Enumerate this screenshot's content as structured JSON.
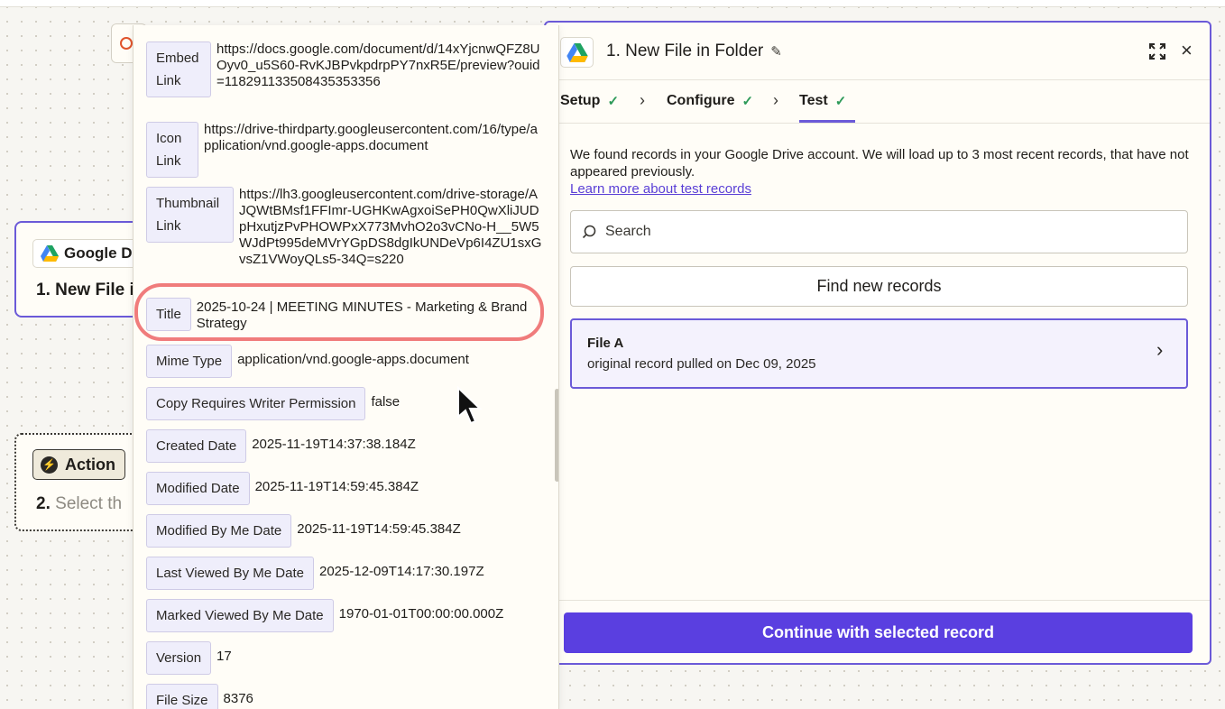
{
  "canvas": {
    "trigger_node": {
      "chip_label": "Google D",
      "title": "1. New File i"
    },
    "action_node": {
      "chip_label": "Action",
      "step_number": "2.",
      "step_text": "Select th"
    }
  },
  "panel": {
    "title": "1. New File in Folder",
    "tabs": [
      {
        "label": "Setup"
      },
      {
        "label": "Configure"
      },
      {
        "label": "Test"
      }
    ],
    "intro_text": "We found records in your Google Drive account. We will load up to 3 most recent records, that have not appeared previously.",
    "learn_more": "Learn more about test records",
    "search_placeholder": "Search",
    "find_button": "Find new records",
    "record": {
      "title": "File A",
      "subtitle": "original record pulled on Dec 09, 2025"
    },
    "continue_button": "Continue with selected record"
  },
  "details": {
    "embed_link": {
      "key": "Embed Link",
      "value": "https://docs.google.com/document/d/14xYjcnwQFZ8UOyv0_u5S60-RvKJBPvkpdrpPY7nxR5E/preview?ouid=118291133508435353356"
    },
    "icon_link": {
      "key": "Icon Link",
      "value": "https://drive-thirdparty.googleusercontent.com/16/type/application/vnd.google-apps.document"
    },
    "thumbnail_link": {
      "key": "Thumbnail Link",
      "value": "https://lh3.googleusercontent.com/drive-storage/AJQWtBMsf1FFImr-UGHKwAgxoiSePH0QwXliJUDpHxutjzPvPHOWPxX773MvhO2o3vCNo-H__5W5WJdPt995deMVrYGpDS8dgIkUNDeVp6I4ZU1sxGvsZ1VWoyQLs5-34Q=s220"
    },
    "title": {
      "key": "Title",
      "value": "2025-10-24 | MEETING MINUTES - Marketing & Brand Strategy"
    },
    "mime_type": {
      "key": "Mime Type",
      "value": "application/vnd.google-apps.document"
    },
    "copy_requires": {
      "key": "Copy Requires Writer Permission",
      "value": "false"
    },
    "created_date": {
      "key": "Created Date",
      "value": "2025-11-19T14:37:38.184Z"
    },
    "modified_date": {
      "key": "Modified Date",
      "value": "2025-11-19T14:59:45.384Z"
    },
    "modified_by_me": {
      "key": "Modified By Me Date",
      "value": "2025-11-19T14:59:45.384Z"
    },
    "last_viewed": {
      "key": "Last Viewed By Me Date",
      "value": "2025-12-09T14:17:30.197Z"
    },
    "marked_viewed": {
      "key": "Marked Viewed By Me Date",
      "value": "1970-01-01T00:00:00.000Z"
    },
    "version": {
      "key": "Version",
      "value": "17"
    },
    "file_size": {
      "key": "File Size",
      "value": "8376"
    }
  },
  "colors": {
    "accent": "#6b5ad8",
    "primary_button": "#5a3fe0",
    "check": "#2d9a59",
    "highlight_ring": "#f07c7c"
  }
}
